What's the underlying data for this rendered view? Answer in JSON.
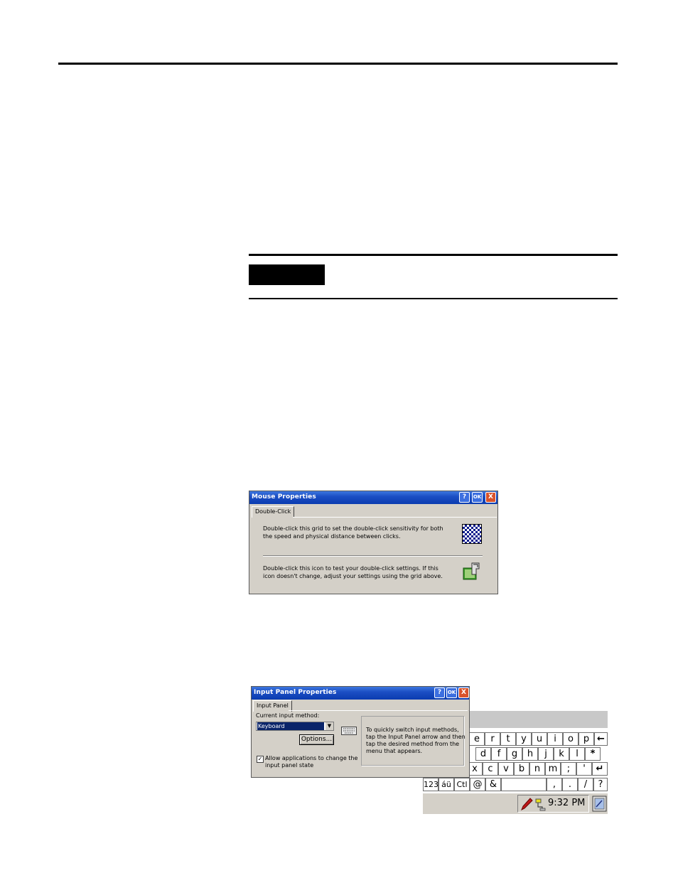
{
  "mouse_dialog": {
    "title": "Mouse Properties",
    "help_btn": "?",
    "ok_btn": "OK",
    "close_btn": "X",
    "tab": "Double-Click",
    "text1_line1": "Double-click this grid to set the double-click sensitivity for both",
    "text1_line2": "the speed and physical distance between clicks.",
    "text2_line1": "Double-click this icon to test your double-click settings. If this",
    "text2_line2": "icon doesn't change, adjust your settings using the grid above."
  },
  "input_dialog": {
    "title": "Input Panel Properties",
    "help_btn": "?",
    "ok_btn": "OK",
    "close_btn": "X",
    "tab": "Input Panel",
    "current_label": "Current input method:",
    "selected_method": "Keyboard",
    "options_btn": "Options...",
    "checkbox_line1": "Allow applications to change the",
    "checkbox_line2": "input panel state",
    "hint_line1": "To quickly switch input methods,",
    "hint_line2": "tap the Input Panel arrow and then",
    "hint_line3": "tap the desired method from the",
    "hint_line4": "menu that appears."
  },
  "keyboard": {
    "row1": [
      "e",
      "r",
      "t",
      "y",
      "u",
      "i",
      "o",
      "p",
      "←"
    ],
    "row2": [
      "d",
      "f",
      "g",
      "h",
      "j",
      "k",
      "l",
      "*"
    ],
    "row3": [
      "x",
      "c",
      "v",
      "b",
      "n",
      "m",
      ";",
      "'",
      "↵"
    ],
    "row4": [
      "123",
      "áü",
      "Ctl",
      "@",
      "&",
      "",
      ",",
      ".",
      "/",
      "?"
    ]
  },
  "taskbar": {
    "time": "9:32 PM"
  }
}
